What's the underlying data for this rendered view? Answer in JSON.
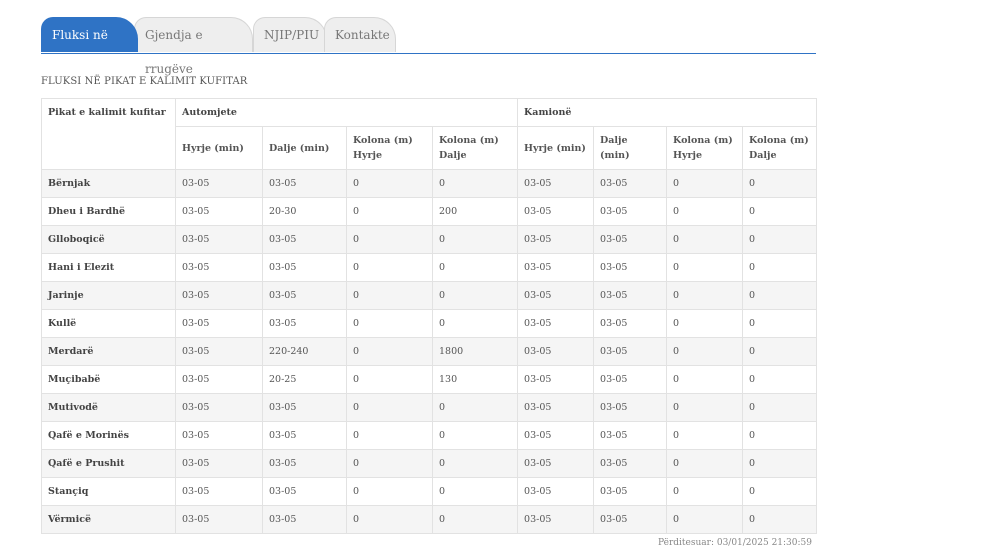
{
  "tabs": [
    {
      "label": "Fluksi në kufi"
    },
    {
      "label": "Gjendja e rrugëve"
    },
    {
      "label": "NJIP/PIU"
    },
    {
      "label": "Kontakte"
    }
  ],
  "section_title": "FLUKSI NË PIKAT E KALIMIT KUFITAR",
  "table": {
    "header_crossing": "Pikat e kalimit kufitar",
    "group_cars": "Automjete",
    "group_trucks": "Kamionë",
    "sub_headers": {
      "entry": "Hyrje (min)",
      "exit": "Dalje (min)",
      "queue_entry": "Kolona (m) Hyrje",
      "queue_exit": "Kolona (m) Dalje"
    },
    "rows": [
      {
        "name": "Bërnjak",
        "c": [
          "03-05",
          "03-05",
          "0",
          "0",
          "03-05",
          "03-05",
          "0",
          "0"
        ]
      },
      {
        "name": "Dheu i Bardhë",
        "c": [
          "03-05",
          "20-30",
          "0",
          "200",
          "03-05",
          "03-05",
          "0",
          "0"
        ]
      },
      {
        "name": "Glloboqicë",
        "c": [
          "03-05",
          "03-05",
          "0",
          "0",
          "03-05",
          "03-05",
          "0",
          "0"
        ]
      },
      {
        "name": "Hani i Elezit",
        "c": [
          "03-05",
          "03-05",
          "0",
          "0",
          "03-05",
          "03-05",
          "0",
          "0"
        ]
      },
      {
        "name": "Jarinje",
        "c": [
          "03-05",
          "03-05",
          "0",
          "0",
          "03-05",
          "03-05",
          "0",
          "0"
        ]
      },
      {
        "name": "Kullë",
        "c": [
          "03-05",
          "03-05",
          "0",
          "0",
          "03-05",
          "03-05",
          "0",
          "0"
        ]
      },
      {
        "name": "Merdarë",
        "c": [
          "03-05",
          "220-240",
          "0",
          "1800",
          "03-05",
          "03-05",
          "0",
          "0"
        ]
      },
      {
        "name": "Muçibabë",
        "c": [
          "03-05",
          "20-25",
          "0",
          "130",
          "03-05",
          "03-05",
          "0",
          "0"
        ]
      },
      {
        "name": "Mutivodë",
        "c": [
          "03-05",
          "03-05",
          "0",
          "0",
          "03-05",
          "03-05",
          "0",
          "0"
        ]
      },
      {
        "name": "Qafë e Morinës",
        "c": [
          "03-05",
          "03-05",
          "0",
          "0",
          "03-05",
          "03-05",
          "0",
          "0"
        ]
      },
      {
        "name": "Qafë e Prushit",
        "c": [
          "03-05",
          "03-05",
          "0",
          "0",
          "03-05",
          "03-05",
          "0",
          "0"
        ]
      },
      {
        "name": "Stançiq",
        "c": [
          "03-05",
          "03-05",
          "0",
          "0",
          "03-05",
          "03-05",
          "0",
          "0"
        ]
      },
      {
        "name": "Vërmicë",
        "c": [
          "03-05",
          "03-05",
          "0",
          "0",
          "03-05",
          "03-05",
          "0",
          "0"
        ]
      }
    ]
  },
  "updated": "Përditesuar: 03/01/2025 21:30:59",
  "colors": {
    "accent": "#2f73c5"
  }
}
